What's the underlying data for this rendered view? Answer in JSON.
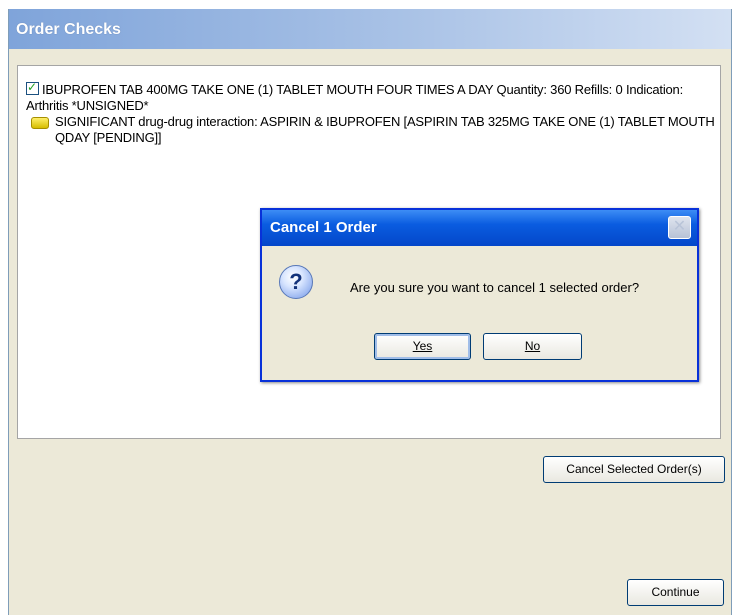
{
  "window": {
    "title": "Order Checks"
  },
  "order": {
    "text": "IBUPROFEN TAB  400MG TAKE ONE (1) TABLET MOUTH FOUR TIMES A DAY Quantity: 360 Refills: 0 Indication: Arthritis *UNSIGNED*",
    "checked": true
  },
  "warning": {
    "text": "SIGNIFICANT drug-drug interaction: ASPIRIN & IBUPROFEN [ASPIRIN TAB  325MG TAKE ONE (1) TABLET MOUTH QDAY  [PENDING]]",
    "icon": "warning-icon",
    "color": "#f2d600"
  },
  "dialog": {
    "title": "Cancel 1 Order",
    "message": "Are you sure you want to cancel 1 selected order?",
    "yes_label": "Yes",
    "no_label": "No",
    "icon": "question-icon",
    "close_glyph": "✕"
  },
  "buttons": {
    "cancel_selected": "Cancel Selected Order(s)",
    "continue": "Continue"
  },
  "colors": {
    "title_bar": "#7fa4da",
    "dialog_title_bar": "#0a5ce0",
    "window_bg": "#ece9d8"
  }
}
